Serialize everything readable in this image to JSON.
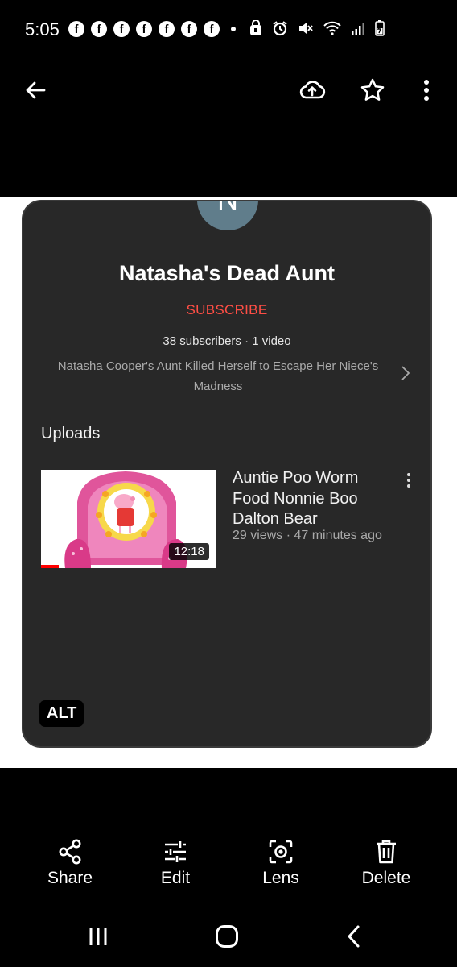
{
  "status_bar": {
    "time": "5:05",
    "notification_icons": [
      "facebook-icon",
      "facebook-icon",
      "facebook-icon",
      "facebook-icon",
      "facebook-icon",
      "facebook-icon",
      "facebook-icon"
    ],
    "system_icons": [
      "secure-folder-icon",
      "alarm-icon",
      "mute-icon",
      "wifi-icon",
      "signal-icon",
      "battery-charging-icon"
    ]
  },
  "top_bar": {
    "icons": [
      "back-arrow-icon",
      "cloud-upload-icon",
      "star-icon",
      "more-vert-icon"
    ]
  },
  "screenshot": {
    "avatar_letter": "N",
    "channel_name": "Natasha's Dead Aunt",
    "subscribe_label": "SUBSCRIBE",
    "stats": "38 subscribers · 1 video",
    "description": "Natasha Cooper's Aunt Killed Herself to Escape Her Niece's Madness",
    "section_title": "Uploads",
    "video": {
      "title": "Auntie Poo Worm Food Nonnie Boo Dalton Bear",
      "meta": "29 views · 47 minutes ago",
      "duration": "12:18",
      "watch_progress": 0.1
    },
    "alt_badge": "ALT"
  },
  "actions": {
    "share": "Share",
    "edit": "Edit",
    "lens": "Lens",
    "delete": "Delete"
  },
  "navbar": {
    "icons": [
      "recents-icon",
      "home-icon",
      "back-icon"
    ]
  },
  "colors": {
    "card_background": "#282828",
    "subscribe": "#ff4e45",
    "avatar": "#607d8b",
    "page_background": "#000000"
  }
}
